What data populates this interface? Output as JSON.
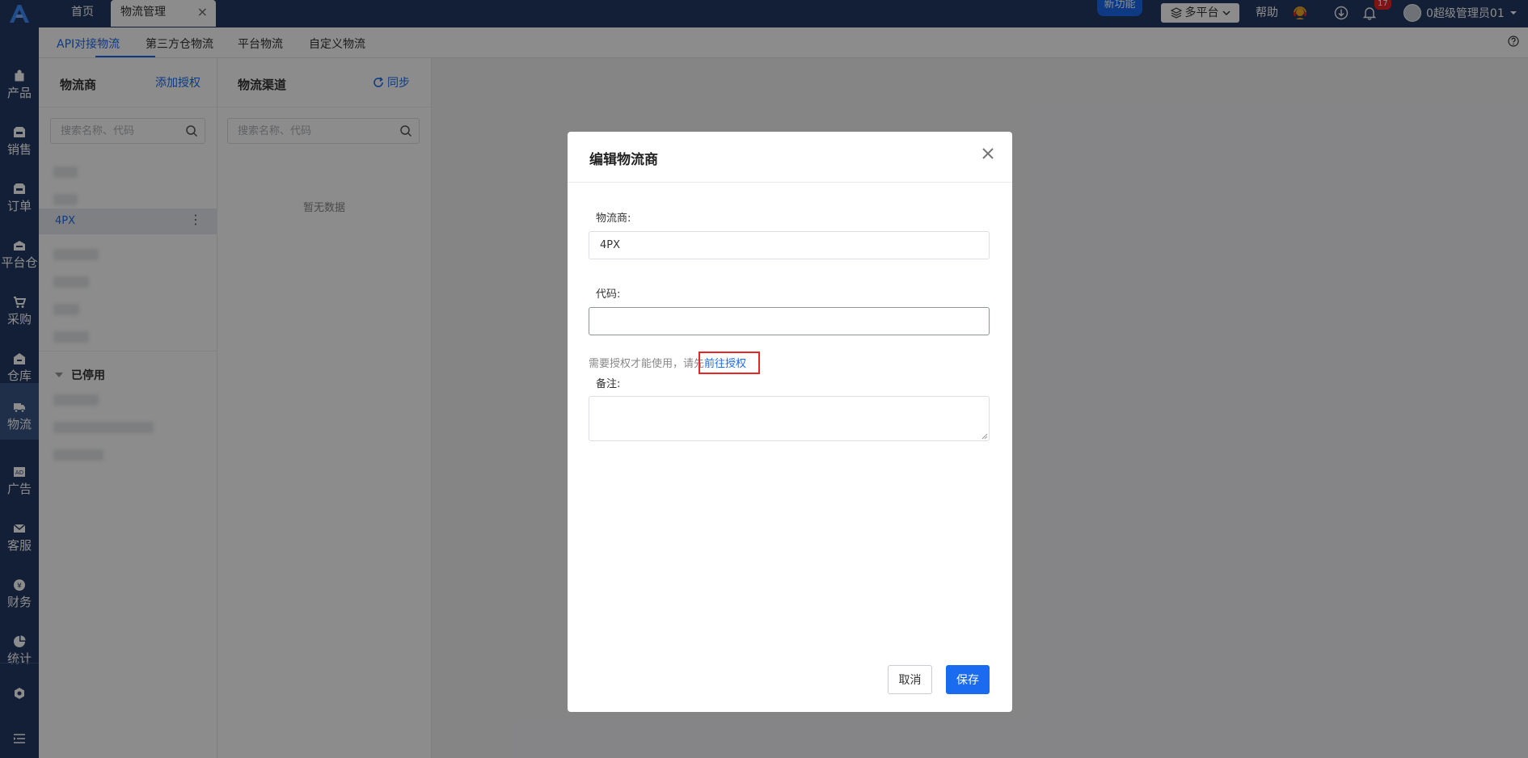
{
  "topbar": {
    "tabs": [
      {
        "label": "首页"
      },
      {
        "label": "物流管理"
      }
    ],
    "new_feature": "新功能",
    "platform": "多平台",
    "help": "帮助",
    "notification_count": "17",
    "username": "0超级管理员01"
  },
  "sidebar": {
    "items": [
      {
        "label": "产品",
        "icon": "bag-icon"
      },
      {
        "label": "销售",
        "icon": "sell-icon"
      },
      {
        "label": "订单",
        "icon": "order-icon"
      },
      {
        "label": "平台仓",
        "icon": "warehouse-icon"
      },
      {
        "label": "采购",
        "icon": "cart-icon"
      },
      {
        "label": "仓库",
        "icon": "house-icon"
      },
      {
        "label": "物流",
        "icon": "truck-icon"
      },
      {
        "label": "广告",
        "icon": "ad-icon"
      },
      {
        "label": "客服",
        "icon": "mail-icon"
      },
      {
        "label": "财务",
        "icon": "yen-icon"
      },
      {
        "label": "统计",
        "icon": "pie-icon"
      }
    ]
  },
  "subtabs": [
    "API对接物流",
    "第三方仓物流",
    "平台物流",
    "自定义物流"
  ],
  "carriers_panel": {
    "title": "物流商",
    "add_link": "添加授权",
    "search_placeholder": "搜索名称、代码",
    "active_carrier": "4PX",
    "disabled_group": "已停用"
  },
  "channels_panel": {
    "title": "物流渠道",
    "sync_link": "同步",
    "search_placeholder": "搜索名称、代码",
    "empty_text": "暂无数据"
  },
  "modal": {
    "title": "编辑物流商",
    "carrier_label": "物流商:",
    "carrier_value": "4PX",
    "code_label": "代码:",
    "code_value": "",
    "hint_text": "需要授权才能使用，请先",
    "hint_link": "前往授权",
    "remark_label": "备注:",
    "cancel": "取消",
    "save": "保存"
  },
  "colors": {
    "nav_bg": "#233a63",
    "accent": "#1a6bf0",
    "highlight": "#e8262a"
  }
}
